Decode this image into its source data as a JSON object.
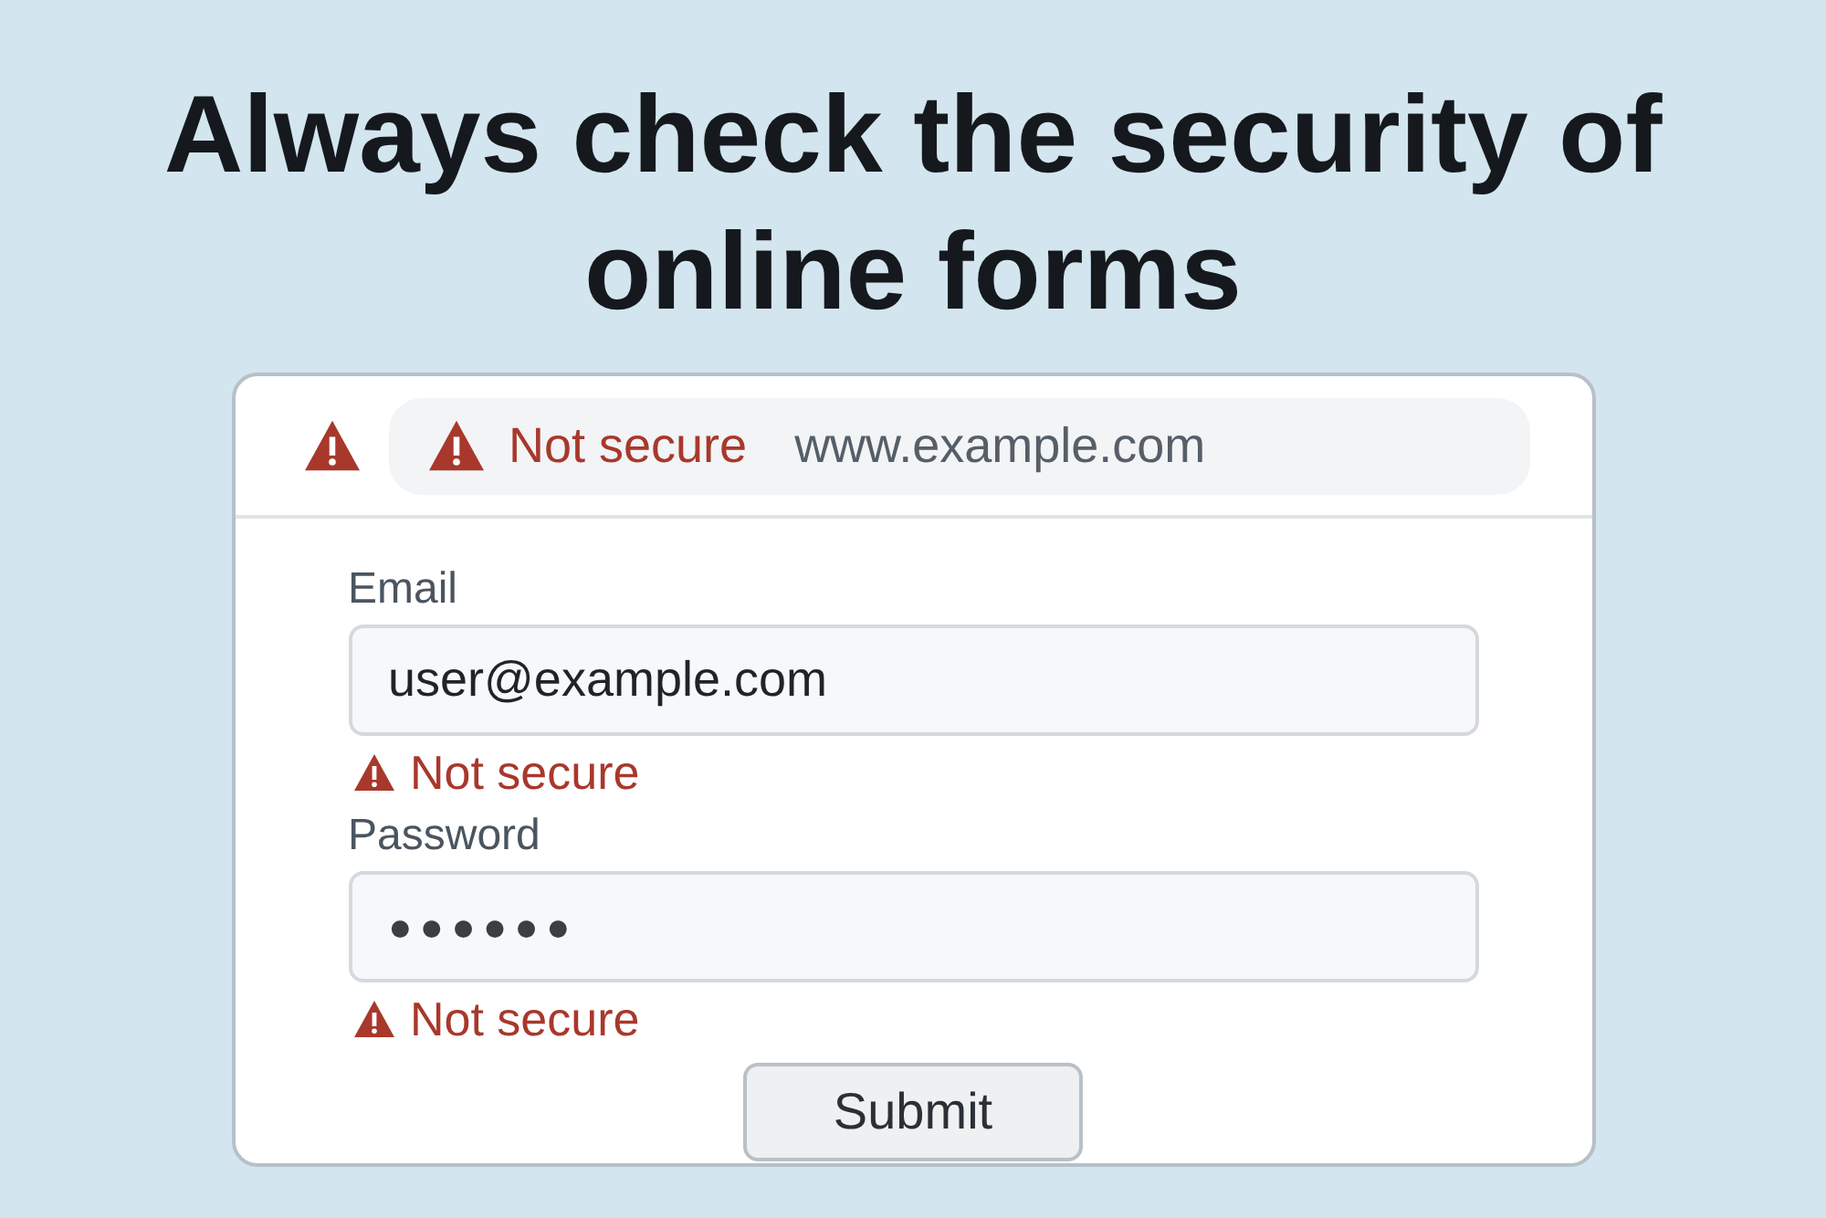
{
  "heading": "Always check the security of online forms",
  "browser": {
    "security_warning": "Not secure",
    "url": "www.example.com"
  },
  "fields": [
    {
      "label": "Email",
      "value": "user@example.com",
      "warning": "Not secure"
    },
    {
      "label": "Password",
      "value": "●●●●●●",
      "warning": "Not secure"
    }
  ],
  "submit": "Submit"
}
